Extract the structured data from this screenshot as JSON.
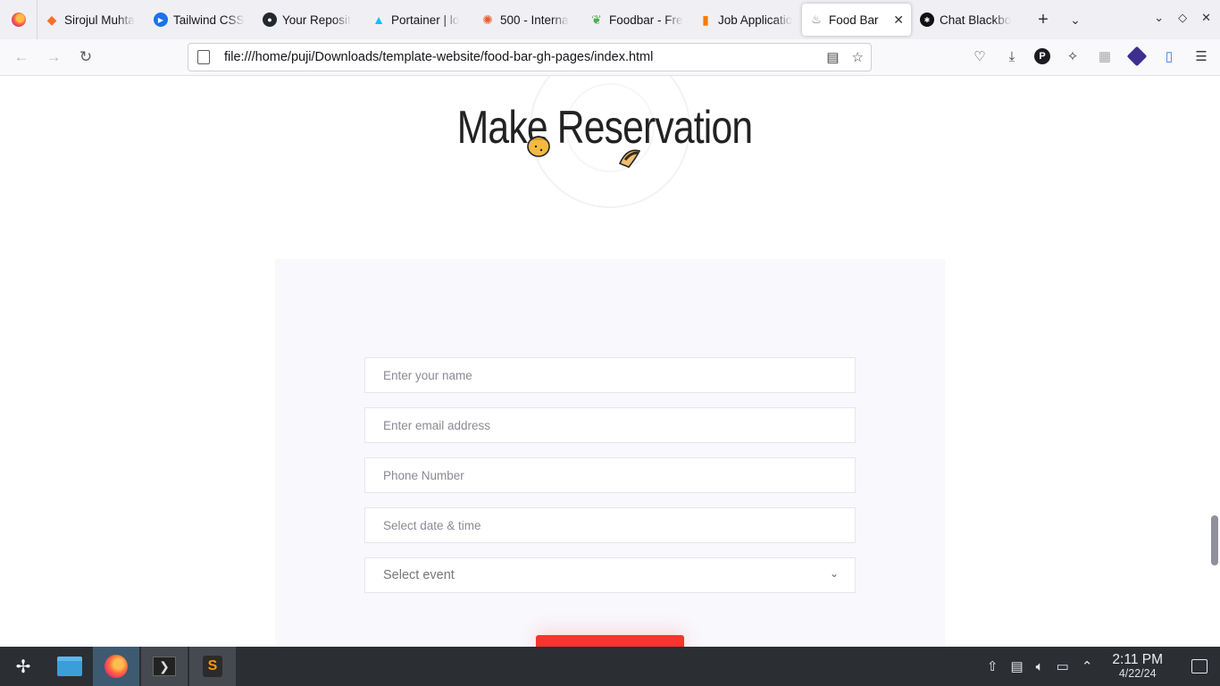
{
  "browser": {
    "tabs": [
      {
        "label": "Sirojul Muhta",
        "icon": "gitlab-icon",
        "color": "#fc6d26"
      },
      {
        "label": "Tailwind CSS",
        "icon": "play-icon",
        "color": "#1a73e8"
      },
      {
        "label": "Your Reposit",
        "icon": "github-icon",
        "color": "#24292f"
      },
      {
        "label": "Portainer | lo",
        "icon": "portainer-icon",
        "color": "#13bef9"
      },
      {
        "label": "500 - Interna",
        "icon": "grafana-icon",
        "color": "#e85a2a"
      },
      {
        "label": "Foodbar - Fre",
        "icon": "leaf-icon",
        "color": "#4caf50"
      },
      {
        "label": "Job Applicatio",
        "icon": "doc-icon",
        "color": "#f57c00"
      },
      {
        "label": "Food Bar",
        "icon": "foodbar-icon",
        "color": "#777777",
        "active": true
      },
      {
        "label": "Chat Blackbo",
        "icon": "blackbox-icon",
        "color": "#111111"
      }
    ],
    "url": "file:///home/puji/Downloads/template-website/food-bar-gh-pages/index.html"
  },
  "page": {
    "title": "Make Reservation",
    "form": {
      "name_placeholder": "Enter your name",
      "email_placeholder": "Enter email address",
      "phone_placeholder": "Phone Number",
      "datetime_placeholder": "Select date & time",
      "event_selected": "Select event"
    }
  },
  "taskbar": {
    "time": "2:11 PM",
    "date": "4/22/24"
  },
  "colors": {
    "accent": "#f7342e",
    "panel": "#f8f8fd"
  }
}
